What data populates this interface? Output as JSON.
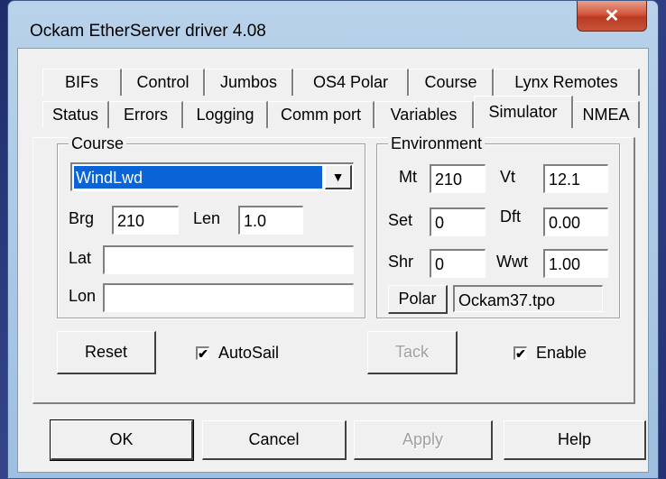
{
  "window": {
    "title": "Ockam EtherServer driver 4.08",
    "close_glyph": "✕"
  },
  "tabs": {
    "row1": [
      "BIFs",
      "Control",
      "Jumbos",
      "OS4 Polar",
      "Course",
      "Lynx Remotes"
    ],
    "row2": [
      "Status",
      "Errors",
      "Logging",
      "Comm port",
      "Variables",
      "Simulator",
      "NMEA"
    ],
    "active": "Simulator"
  },
  "course": {
    "group_label": "Course",
    "selected": "WindLwd",
    "brg_label": "Brg",
    "brg_value": "210",
    "len_label": "Len",
    "len_value": "1.0",
    "lat_label": "Lat",
    "lat_value": "",
    "lon_label": "Lon",
    "lon_value": ""
  },
  "environment": {
    "group_label": "Environment",
    "mt_label": "Mt",
    "mt_value": "210",
    "vt_label": "Vt",
    "vt_value": "12.1",
    "set_label": "Set",
    "set_value": "0",
    "dft_label": "Dft",
    "dft_value": "0.00",
    "shr_label": "Shr",
    "shr_value": "0",
    "wwt_label": "Wwt",
    "wwt_value": "1.00",
    "polar_button": "Polar",
    "polar_file": "Ockam37.tpo"
  },
  "actions": {
    "reset": "Reset",
    "autosail_label": "AutoSail",
    "autosail_checked": "✔",
    "tack": "Tack",
    "enable_label": "Enable",
    "enable_checked": "✔"
  },
  "footer": {
    "ok": "OK",
    "cancel": "Cancel",
    "apply": "Apply",
    "help": "Help"
  },
  "colors": {
    "selection": "#0a64d8",
    "close_button": "#c9543a",
    "dialog_face": "#f0f0f0"
  }
}
